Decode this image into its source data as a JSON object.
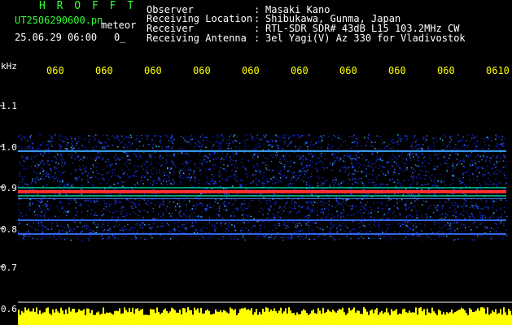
{
  "header": {
    "program": "H R O F F T",
    "file": "UT2506290600.pn",
    "mode": "meteor",
    "datetime": "25.06.29 06:00",
    "count": "0_",
    "fields": [
      {
        "label": "Observer",
        "value": "Masaki Kano"
      },
      {
        "label": "Receiving Location",
        "value": "Shibukawa, Gunma, Japan"
      },
      {
        "label": "Receiver",
        "value": "RTL-SDR SDR# 43dB L15 103.2MHz CW"
      },
      {
        "label": "Receiving Antenna",
        "value": "3el Yagi(V) Az 330 for Vladivostok"
      }
    ]
  },
  "axis": {
    "unit": "kHz",
    "time_ticks": [
      "060",
      "060",
      "060",
      "060",
      "060",
      "060",
      "060",
      "060",
      "060",
      "0610"
    ],
    "freq_ticks": [
      "1.1",
      "1.0",
      "0.9",
      "0.8",
      "0.7",
      "0.6"
    ]
  },
  "colors": {
    "text": "#ffffff",
    "title": "#33ff33",
    "ticks": "#ffff00",
    "level": "#ffff00"
  }
}
